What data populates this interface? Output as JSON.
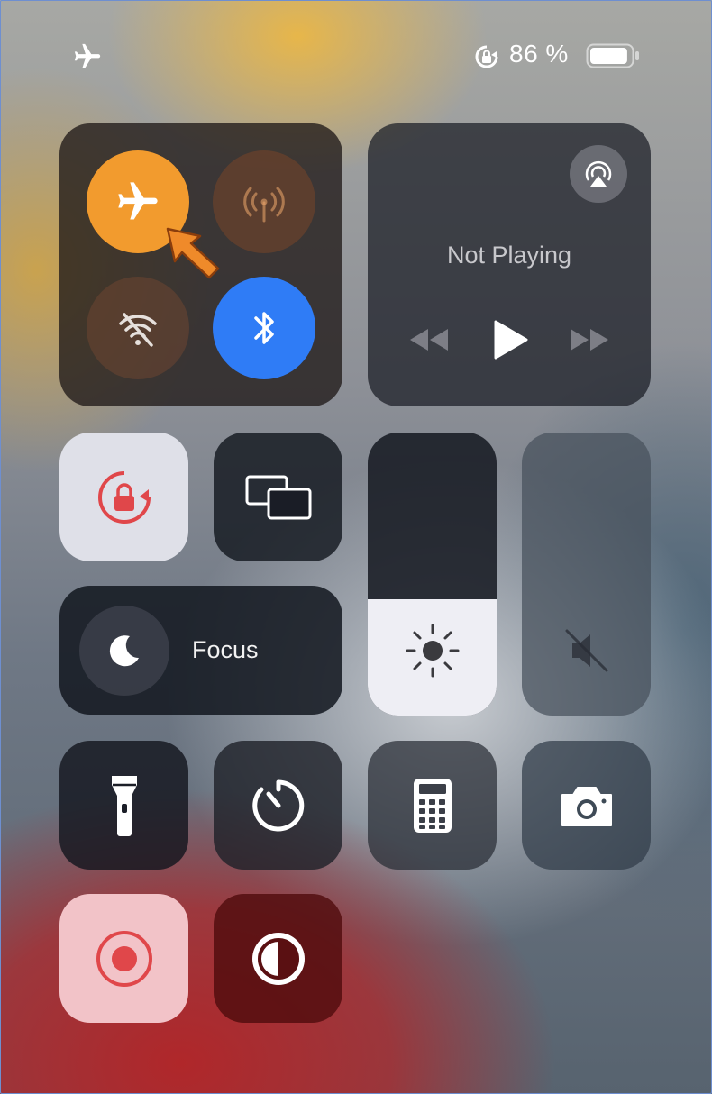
{
  "status_bar": {
    "airplane_icon": "airplane-icon",
    "rotation_lock_icon": "rotation-lock-icon",
    "battery_percent": "86 %",
    "battery_level": 0.86
  },
  "connectivity": {
    "airplane_mode": {
      "icon": "airplane-icon",
      "active": true,
      "color": "#f29b2e"
    },
    "cellular": {
      "icon": "antenna-icon",
      "active": false
    },
    "wifi": {
      "icon": "wifi-off-icon",
      "active": false
    },
    "bluetooth": {
      "icon": "bluetooth-icon",
      "active": true,
      "color": "#2f7cf6"
    }
  },
  "now_playing": {
    "title": "Not Playing",
    "airplay_icon": "airplay-icon",
    "controls": [
      "rewind-icon",
      "play-icon",
      "fast-forward-icon"
    ]
  },
  "toggles": {
    "rotation_lock": {
      "icon": "rotation-lock-icon",
      "active": true,
      "accent": "#e0474a"
    },
    "screen_mirroring": {
      "icon": "screen-mirroring-icon"
    }
  },
  "focus": {
    "label": "Focus",
    "icon": "moon-icon"
  },
  "sliders": {
    "brightness": {
      "icon": "sun-icon",
      "level": 0.41
    },
    "volume": {
      "icon": "speaker-muted-icon",
      "level": 0
    }
  },
  "utilities": [
    "flashlight-icon",
    "timer-icon",
    "calculator-icon",
    "camera-icon"
  ],
  "bottom_row": {
    "screen_record": {
      "icon": "record-icon",
      "accent": "#e0474a"
    },
    "dark_mode": {
      "icon": "dark-mode-icon"
    }
  },
  "colors": {
    "accent_orange": "#f29b2e",
    "bluetooth_blue": "#2f7cf6"
  }
}
